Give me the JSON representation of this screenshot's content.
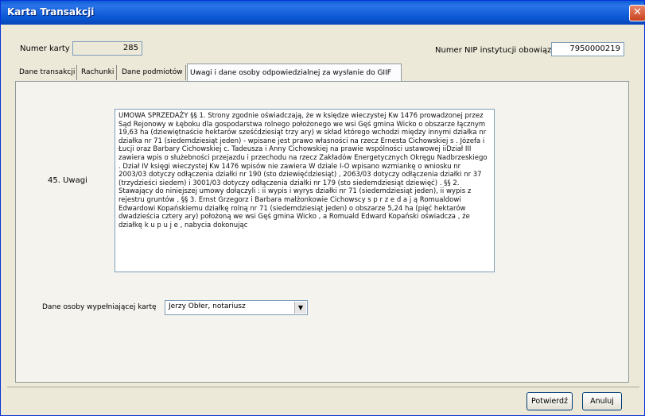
{
  "window": {
    "title": "Karta Transakcji",
    "close_glyph": "✕"
  },
  "header": {
    "card_number_label": "Numer karty",
    "card_number_value": "285",
    "nip_label": "Numer NIP instytucji obowiązanej",
    "nip_value": "7950000219"
  },
  "tabs": [
    {
      "label": "Dane transakcji"
    },
    {
      "label": "Rachunki"
    },
    {
      "label": "Dane podmiotów"
    },
    {
      "label": "Uwagi i dane osoby odpowiedzialnej za wysłanie do GIIF"
    }
  ],
  "notes": {
    "label": "45. Uwagi",
    "text": "UMOWA  SPRZEDAŻY        §§ 1. Strony zgodnie oświadczają, że w księdze wieczystej Kw 1476 prowadzonej przez Sąd Rejonowy w  Łęboku dla gospodarstwa rolnego  położonego we wsi Gęś gmina Wicko  o obszarze łącznym 19,63 ha (dziewiętnaście hektarów sześćdziesiąt trzy ary) w skład którego wchodzi między innymi działka nr  działka nr 71 (siedemdziesiąt jeden) - wpisane jest prawo własności na rzecz  Ernesta  Cichowskiej s . Józefa i Łucji oraz Barbary Cichowskiej c. Tadeusza i Anny Cichowskiej  na prawie wspólności  ustawowej  iiDział III zawiera wpis o  służebności przejazdu i przechodu na rzecz Zakładów Energetycznych Okręgu Nadbrzeskiego . Dział IV księgi wieczystej Kw 1476 wpisów nie zawiera  W dziale I-O wpisano wzmiankę o wniosku nr 2003/03 dotyczy odłączenia działki nr 190 (sto dziewięćdziesiąt) , 2063/03 dotyczy odłączenia działki nr 37 (trzydzieści siedem) i 3001/03 dotyczy odłączenia działki nr 179 (sto siedemdziesiąt dziewięć) . §§ 2. Stawający do niniejszej umowy dołączyli : ii wypis i wyrys  działki nr 71 (siedemdziesiąt jeden), ii wypis z rejestru gruntów , §§ 3. Ernst Grzegorz i Barbara małżonkowie Cichowscy  s p r z e d a j ą  Romualdowi Edwardowi Kopańskiemu działkę rolną nr 71 (siedemdziesiąt jeden)  o obszarze 5,24 ha (pięć hektarów dwadzieścia cztery ary)  położoną we wsi Gęś gmina Wicko ,  a  Romuald Edward Kopański  oświadcza , że  działkę    k u p u j e ,  nabycia dokonując"
  },
  "person": {
    "label": "Dane osoby wypełniającej kartę",
    "selected": "Jerzy Obłer, notariusz",
    "arrow_glyph": "▼"
  },
  "buttons": {
    "confirm": "Potwierdź",
    "cancel": "Anuluj"
  },
  "colors": {
    "titlebar": "#0a58d4",
    "window_bg": "#ece9d8",
    "close_button": "#c9421e"
  }
}
